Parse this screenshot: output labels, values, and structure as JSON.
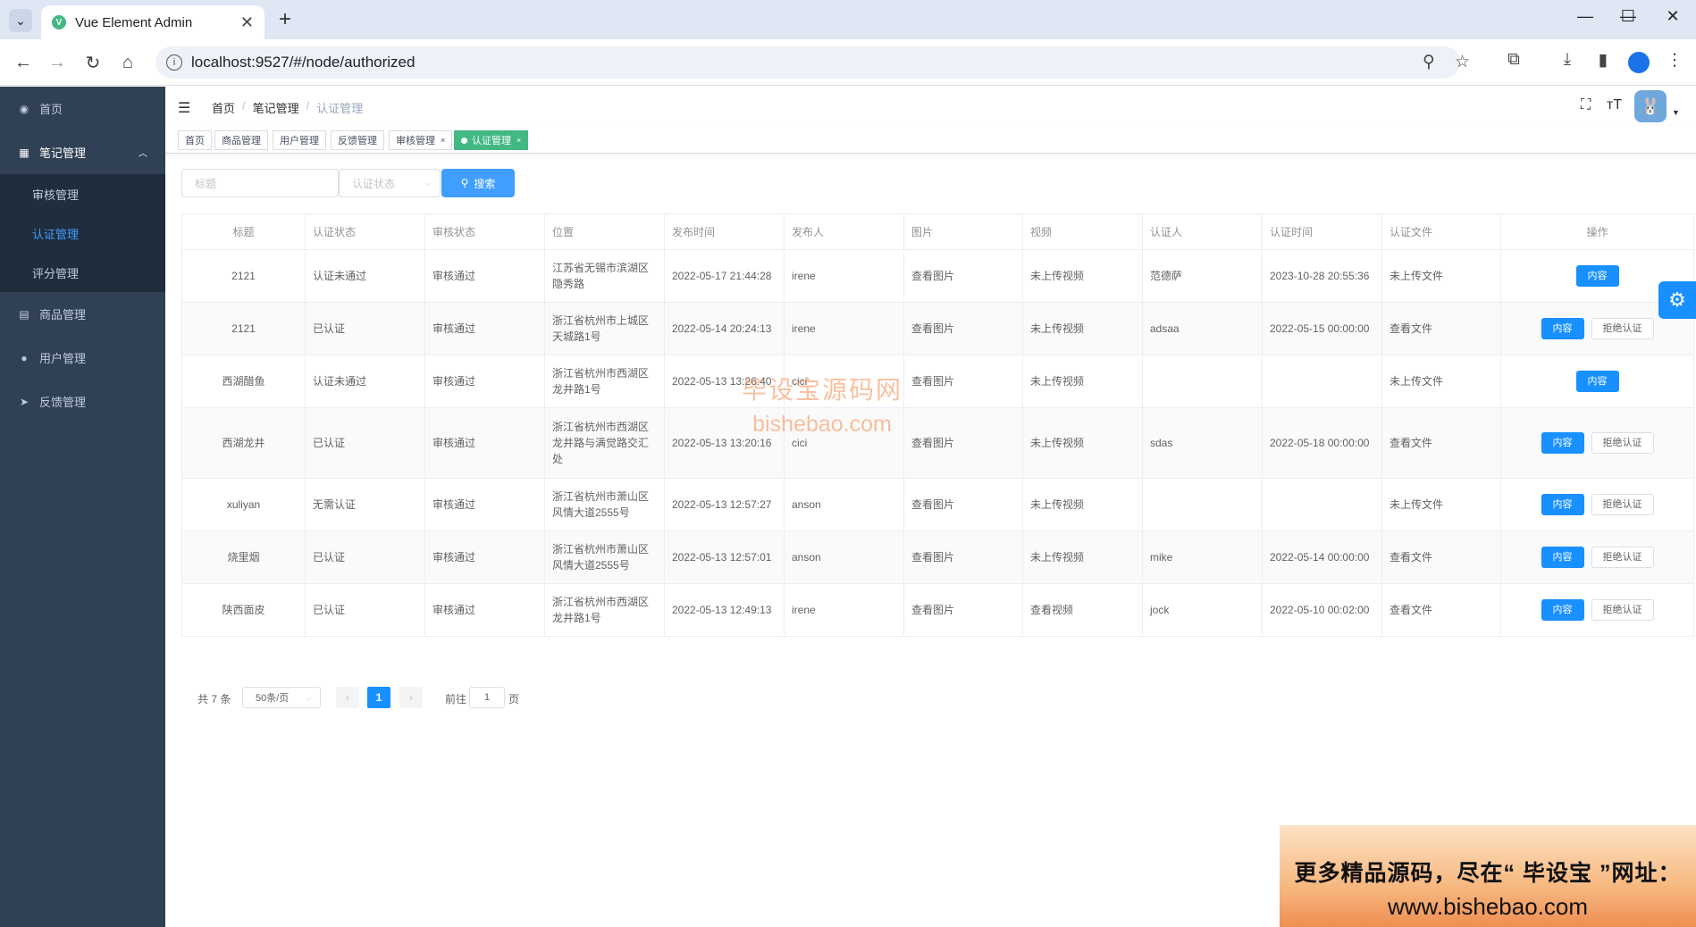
{
  "browser": {
    "tab_title": "Vue Element Admin",
    "url": "localhost:9527/#/node/authorized"
  },
  "sidebar": {
    "items": [
      {
        "label": "首页",
        "icon": "dashboard-icon"
      },
      {
        "label": "笔记管理",
        "icon": "table-icon"
      },
      {
        "label": "商品管理",
        "icon": "document-icon"
      },
      {
        "label": "用户管理",
        "icon": "user-icon"
      },
      {
        "label": "反馈管理",
        "icon": "send-icon"
      }
    ],
    "submenu": [
      {
        "label": "审核管理"
      },
      {
        "label": "认证管理"
      },
      {
        "label": "评分管理"
      }
    ]
  },
  "breadcrumb": [
    "首页",
    "笔记管理",
    "认证管理"
  ],
  "tags": [
    "首页",
    "商品管理",
    "用户管理",
    "反馈管理",
    "审核管理",
    "认证管理"
  ],
  "filter": {
    "title_placeholder": "标题",
    "status_placeholder": "认证状态",
    "search_label": "搜索"
  },
  "table": {
    "headers": [
      "标题",
      "认证状态",
      "审核状态",
      "位置",
      "发布时间",
      "发布人",
      "图片",
      "视频",
      "认证人",
      "认证时间",
      "认证文件",
      "操作"
    ],
    "rows": [
      {
        "title": "2121",
        "auth_status": "认证未通过",
        "review_status": "审核通过",
        "location": "江苏省无锡市滨湖区隐秀路",
        "publish_time": "2022-05-17 21:44:28",
        "publisher": "irene",
        "image": "查看图片",
        "video": "未上传视频",
        "certifier": "范德萨",
        "auth_time": "2023-10-28 20:55:36",
        "auth_file": "未上传文件",
        "reject": false
      },
      {
        "title": "2121",
        "auth_status": "已认证",
        "review_status": "审核通过",
        "location": "浙江省杭州市上城区天城路1号",
        "publish_time": "2022-05-14 20:24:13",
        "publisher": "irene",
        "image": "查看图片",
        "video": "未上传视频",
        "certifier": "adsaa",
        "auth_time": "2022-05-15 00:00:00",
        "auth_file": "查看文件",
        "reject": true
      },
      {
        "title": "西湖醋鱼",
        "auth_status": "认证未通过",
        "review_status": "审核通过",
        "location": "浙江省杭州市西湖区龙井路1号",
        "publish_time": "2022-05-13 13:26:40",
        "publisher": "cici",
        "image": "查看图片",
        "video": "未上传视频",
        "certifier": "",
        "auth_time": "",
        "auth_file": "未上传文件",
        "reject": false
      },
      {
        "title": "西湖龙井",
        "auth_status": "已认证",
        "review_status": "审核通过",
        "location": "浙江省杭州市西湖区龙井路与满觉路交汇处",
        "publish_time": "2022-05-13 13:20:16",
        "publisher": "cici",
        "image": "查看图片",
        "video": "未上传视频",
        "certifier": "sdas",
        "auth_time": "2022-05-18 00:00:00",
        "auth_file": "查看文件",
        "reject": true
      },
      {
        "title": "xuliyan",
        "auth_status": "无需认证",
        "review_status": "审核通过",
        "location": "浙江省杭州市萧山区风情大道2555号",
        "publish_time": "2022-05-13 12:57:27",
        "publisher": "anson",
        "image": "查看图片",
        "video": "未上传视频",
        "certifier": "",
        "auth_time": "",
        "auth_file": "未上传文件",
        "reject": true
      },
      {
        "title": "烧里烟",
        "auth_status": "已认证",
        "review_status": "审核通过",
        "location": "浙江省杭州市萧山区风情大道2555号",
        "publish_time": "2022-05-13 12:57:01",
        "publisher": "anson",
        "image": "查看图片",
        "video": "未上传视频",
        "certifier": "mike",
        "auth_time": "2022-05-14 00:00:00",
        "auth_file": "查看文件",
        "reject": true
      },
      {
        "title": "陕西面皮",
        "auth_status": "已认证",
        "review_status": "审核通过",
        "location": "浙江省杭州市西湖区龙井路1号",
        "publish_time": "2022-05-13 12:49:13",
        "publisher": "irene",
        "image": "查看图片",
        "video": "查看视频",
        "certifier": "jock",
        "auth_time": "2022-05-10 00:02:00",
        "auth_file": "查看文件",
        "reject": true
      }
    ],
    "action_content": "内容",
    "action_reject": "拒绝认证"
  },
  "pagination": {
    "total_text": "共 7 条",
    "page_size": "50条/页",
    "current_page": "1",
    "goto_prefix": "前往",
    "goto_value": "1",
    "goto_suffix": "页"
  },
  "watermark": {
    "line1": "毕设宝源码网",
    "line2": "bishebao.com"
  },
  "ad": {
    "line1": "更多精品源码，尽在“ 毕设宝 ”网址：",
    "line2": "www.bishebao.com"
  },
  "colors": {
    "sidebar_bg": "#304156",
    "primary": "#1890ff",
    "active_tag": "#42b983",
    "active_menu": "#409eff"
  }
}
